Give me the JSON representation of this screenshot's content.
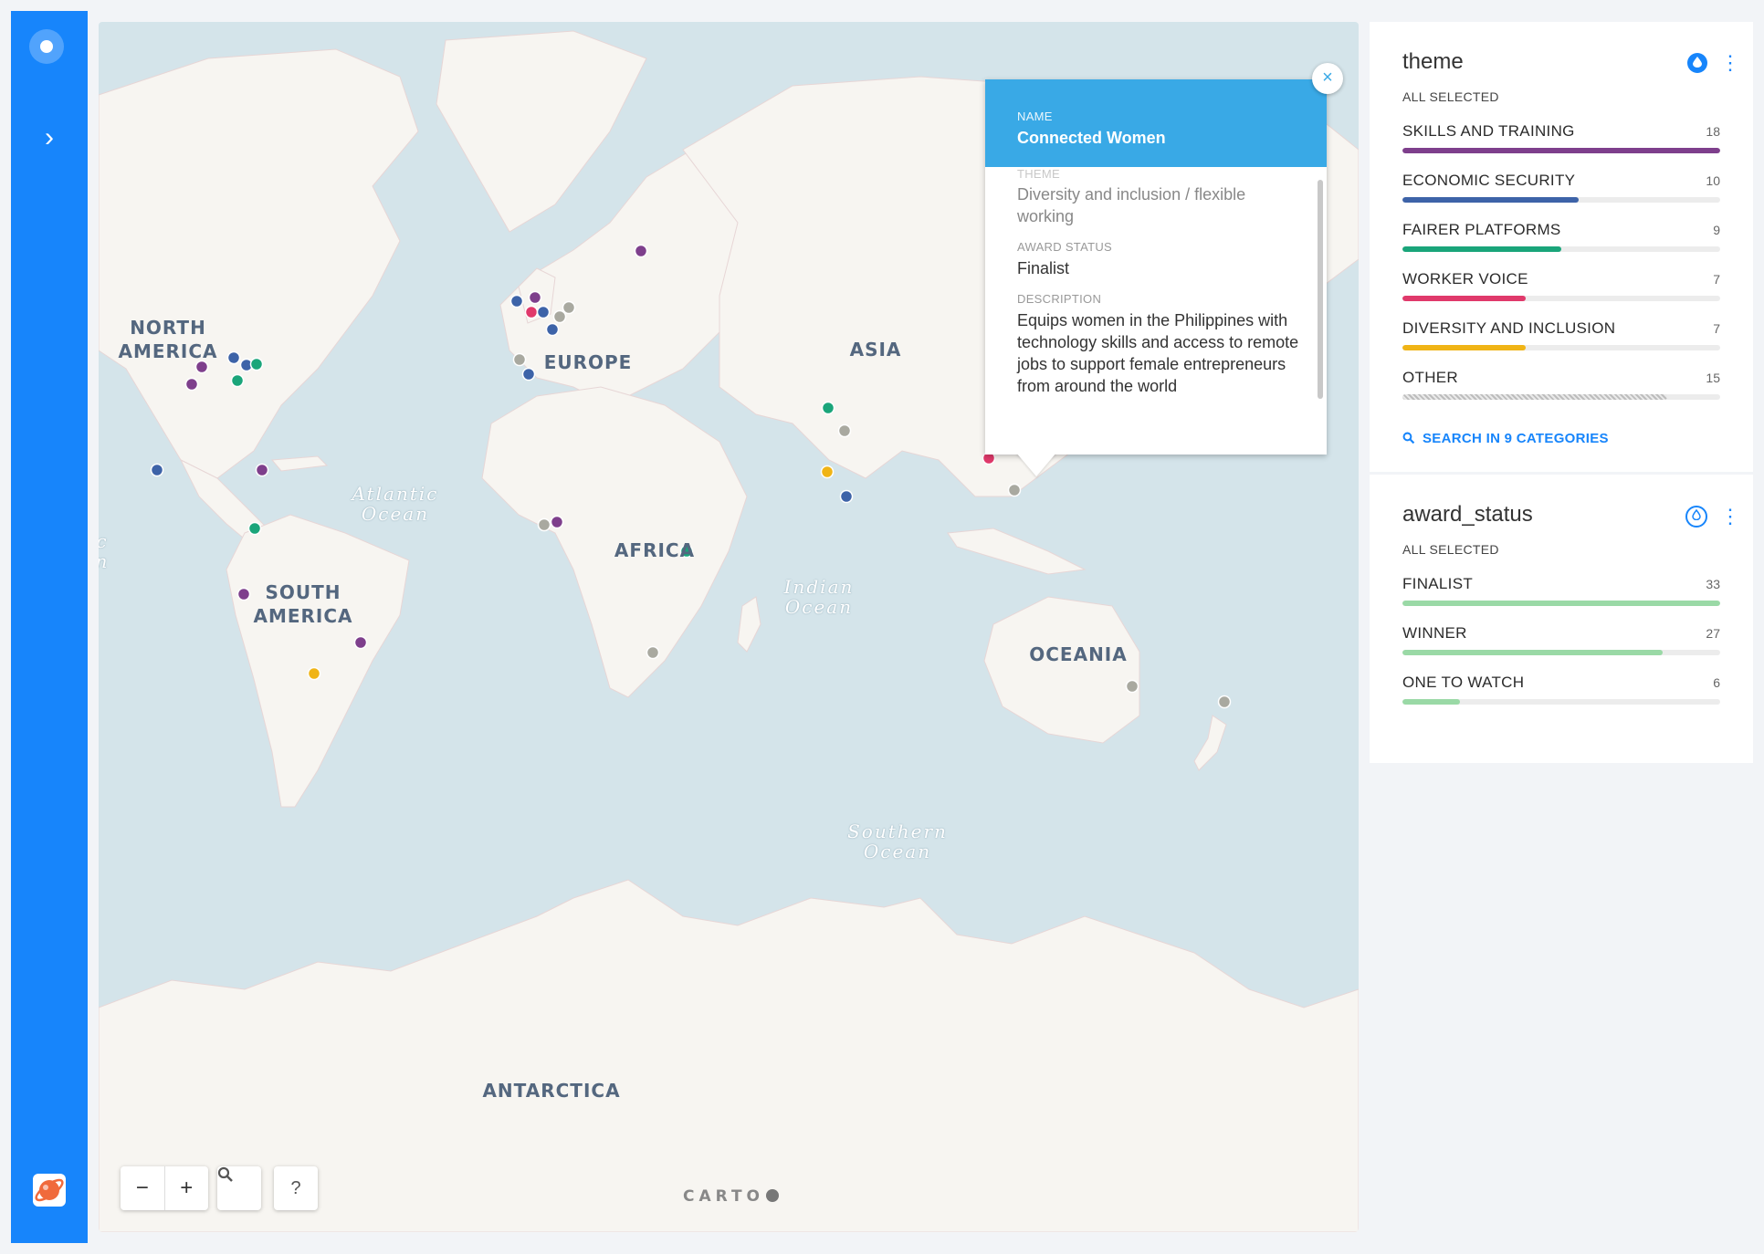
{
  "sidebar": {
    "top_icon": "circle-dot-icon",
    "expand_icon": "chevron-right-icon",
    "logo_icon": "planet-logo-icon",
    "expand_glyph": "›"
  },
  "map": {
    "continents": [
      {
        "id": "north-america",
        "text": "NORTH\nAMERICA"
      },
      {
        "id": "south-america",
        "text": "SOUTH\nAMERICA"
      },
      {
        "id": "europe",
        "text": "EUROPE"
      },
      {
        "id": "africa",
        "text": "AFRICA"
      },
      {
        "id": "asia",
        "text": "ASIA"
      },
      {
        "id": "oceania",
        "text": "OCEANIA"
      },
      {
        "id": "antarctica",
        "text": "ANTARCTICA"
      }
    ],
    "oceans": [
      {
        "id": "atlantic",
        "text": "Atlantic\nOcean"
      },
      {
        "id": "indian",
        "text": "Indian\nOcean"
      },
      {
        "id": "southern",
        "text": "Southern\nOcean"
      },
      {
        "id": "pacific-clip",
        "text": "c\nn"
      }
    ],
    "controls": {
      "zoom_out": "−",
      "zoom_in": "+",
      "search": "🔍",
      "help": "?"
    },
    "attribution": "CARTO",
    "marker_colors": {
      "purple": "#7e3f8c",
      "blue": "#3d63a8",
      "green": "#1aa57a",
      "pink": "#e0396b",
      "yellow": "#f0b416",
      "gray": "#a9a9a0"
    }
  },
  "popup": {
    "close_glyph": "×",
    "name_key": "NAME",
    "name_value": "Connected Women",
    "theme_key": "THEME",
    "theme_value": "Diversity and inclusion / flexible working",
    "status_key": "AWARD STATUS",
    "status_value": "Finalist",
    "desc_key": "DESCRIPTION",
    "desc_value": "Equips women in the Philippines with technology skills and access to remote jobs to support female entrepreneurs from around the world"
  },
  "widgets": {
    "theme": {
      "title": "theme",
      "subtitle": "ALL SELECTED",
      "categories": [
        {
          "name": "SKILLS AND TRAINING",
          "count": "18",
          "fraction": 1.0,
          "color": "#7e3f8c"
        },
        {
          "name": "ECONOMIC SECURITY",
          "count": "10",
          "fraction": 0.556,
          "color": "#3d63a8"
        },
        {
          "name": "FAIRER PLATFORMS",
          "count": "9",
          "fraction": 0.5,
          "color": "#1aa57a"
        },
        {
          "name": "WORKER VOICE",
          "count": "7",
          "fraction": 0.389,
          "color": "#e0396b"
        },
        {
          "name": "DIVERSITY AND INCLUSION",
          "count": "7",
          "fraction": 0.389,
          "color": "#f0b416"
        },
        {
          "name": "OTHER",
          "count": "15",
          "fraction": 0.833,
          "color": "hatched"
        }
      ],
      "search_label": "SEARCH IN 9 CATEGORIES"
    },
    "award_status": {
      "title": "award_status",
      "subtitle": "ALL SELECTED",
      "categories": [
        {
          "name": "FINALIST",
          "count": "33",
          "fraction": 1.0,
          "color": "#9ad9a6"
        },
        {
          "name": "WINNER",
          "count": "27",
          "fraction": 0.818,
          "color": "#9ad9a6"
        },
        {
          "name": "ONE TO WATCH",
          "count": "6",
          "fraction": 0.182,
          "color": "#9ad9a6"
        }
      ]
    }
  }
}
